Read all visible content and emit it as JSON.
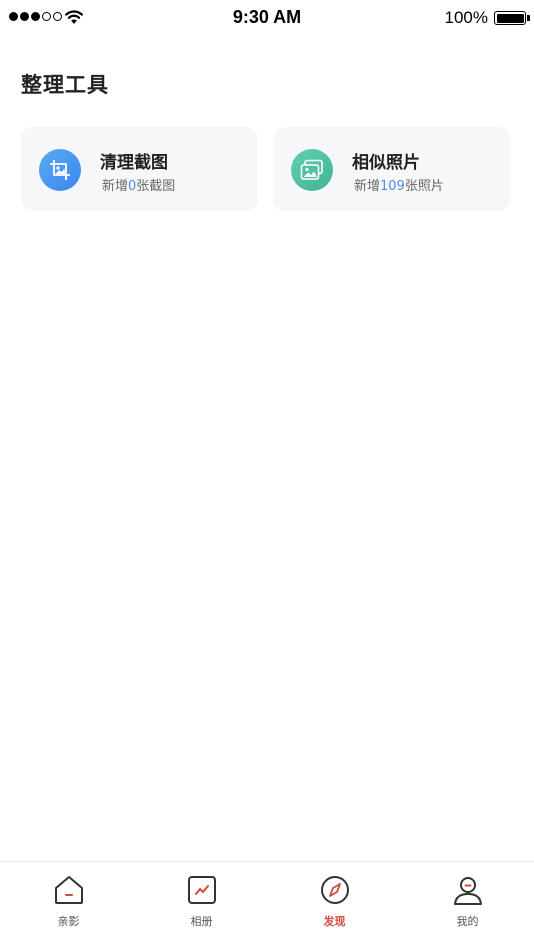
{
  "status_bar": {
    "time": "9:30 AM",
    "battery": "100%"
  },
  "section": {
    "title": "整理工具"
  },
  "cards": [
    {
      "title": "清理截图",
      "sub_prefix": "新增",
      "count": "0",
      "sub_suffix": "张截图",
      "icon": "screenshot-crop-icon",
      "color": "#4a98f2"
    },
    {
      "title": "相似照片",
      "sub_prefix": "新增",
      "count": "109",
      "sub_suffix": "张照片",
      "icon": "similar-photos-icon",
      "color": "#4fc2a3"
    }
  ],
  "tabs": [
    {
      "label": "亲影",
      "icon": "home-icon",
      "active": false
    },
    {
      "label": "相册",
      "icon": "album-icon",
      "active": false
    },
    {
      "label": "发现",
      "icon": "compass-icon",
      "active": true
    },
    {
      "label": "我的",
      "icon": "profile-icon",
      "active": false
    }
  ],
  "colors": {
    "accent_blue": "#4f8fe6",
    "active_tab": "#d24b3f",
    "card_bg": "#f6f7f9"
  }
}
